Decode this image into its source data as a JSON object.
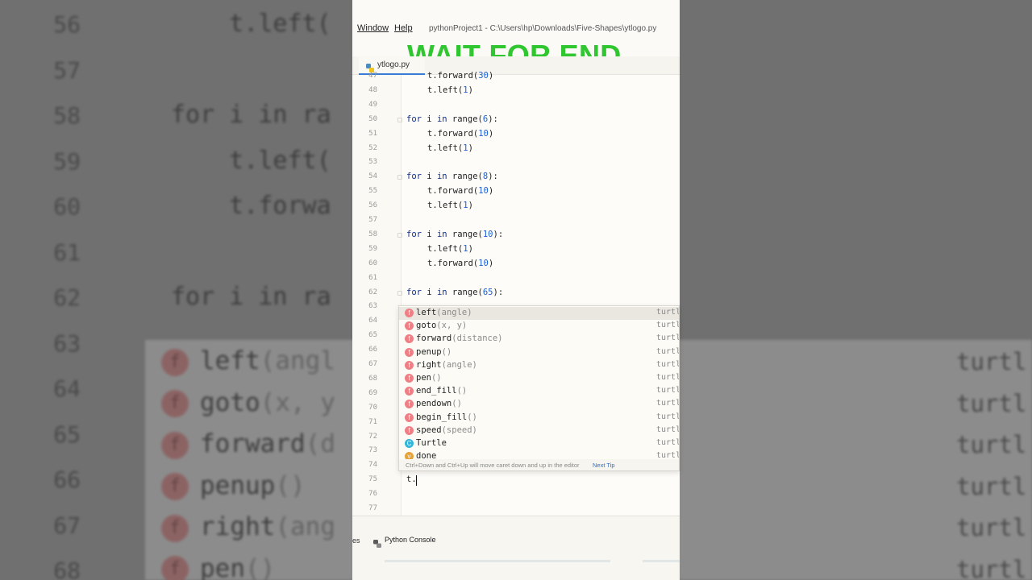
{
  "menu": {
    "window": "Window",
    "help": "Help"
  },
  "title_path": "pythonProject1 - C:\\Users\\hp\\Downloads\\Five-Shapes\\ytlogo.py",
  "overlay_text": "WAIT FOR END",
  "tab": {
    "filename": "ytlogo.py"
  },
  "left_dash": "-",
  "editor": {
    "lines": [
      {
        "n": "47",
        "kind": "code",
        "indent": 1,
        "text": "t.forward(30)"
      },
      {
        "n": "48",
        "kind": "code",
        "indent": 1,
        "text": "t.left(1)"
      },
      {
        "n": "49",
        "kind": "blank"
      },
      {
        "n": "50",
        "kind": "for",
        "num": "6"
      },
      {
        "n": "51",
        "kind": "code",
        "indent": 1,
        "text": "t.forward(10)"
      },
      {
        "n": "52",
        "kind": "code",
        "indent": 1,
        "text": "t.left(1)"
      },
      {
        "n": "53",
        "kind": "blank"
      },
      {
        "n": "54",
        "kind": "for",
        "num": "8"
      },
      {
        "n": "55",
        "kind": "code",
        "indent": 1,
        "text": "t.forward(10)"
      },
      {
        "n": "56",
        "kind": "code",
        "indent": 1,
        "text": "t.left(1)"
      },
      {
        "n": "57",
        "kind": "blank"
      },
      {
        "n": "58",
        "kind": "for",
        "num": "10"
      },
      {
        "n": "59",
        "kind": "code",
        "indent": 1,
        "text": "t.left(1)"
      },
      {
        "n": "60",
        "kind": "code",
        "indent": 1,
        "text": "t.forward(10)"
      },
      {
        "n": "61",
        "kind": "blank"
      },
      {
        "n": "62",
        "kind": "for",
        "num": "65"
      },
      {
        "n": "63",
        "kind": "blank"
      },
      {
        "n": "64",
        "kind": "blank"
      },
      {
        "n": "65",
        "kind": "blank"
      },
      {
        "n": "66",
        "kind": "blank"
      },
      {
        "n": "67",
        "kind": "blank"
      },
      {
        "n": "68",
        "kind": "blank"
      },
      {
        "n": "69",
        "kind": "blank"
      },
      {
        "n": "70",
        "kind": "blank"
      },
      {
        "n": "71",
        "kind": "blank"
      },
      {
        "n": "72",
        "kind": "blank"
      },
      {
        "n": "73",
        "kind": "blank"
      },
      {
        "n": "74",
        "kind": "blank"
      },
      {
        "n": "75",
        "kind": "code",
        "indent": 0,
        "text": "t."
      },
      {
        "n": "76",
        "kind": "blank"
      },
      {
        "n": "77",
        "kind": "blank"
      }
    ],
    "for_prefix": "for",
    "for_var": " i ",
    "for_in": "in",
    "for_range": " range(",
    "for_suffix": "):"
  },
  "completion": {
    "items": [
      {
        "name": "left",
        "params": "(angle)",
        "icon": "f",
        "type": "function",
        "source": "turtl",
        "selected": true
      },
      {
        "name": "goto",
        "params": "(x, y)",
        "icon": "f",
        "type": "function",
        "source": "turtl"
      },
      {
        "name": "forward",
        "params": "(distance)",
        "icon": "f",
        "type": "function",
        "source": "turtl"
      },
      {
        "name": "penup",
        "params": "()",
        "icon": "f",
        "type": "function",
        "source": "turtl"
      },
      {
        "name": "right",
        "params": "(angle)",
        "icon": "f",
        "type": "function",
        "source": "turtl"
      },
      {
        "name": "pen",
        "params": "()",
        "icon": "f",
        "type": "function",
        "source": "turtl"
      },
      {
        "name": "end_fill",
        "params": "()",
        "icon": "f",
        "type": "function",
        "source": "turtl"
      },
      {
        "name": "pendown",
        "params": "()",
        "icon": "f",
        "type": "function",
        "source": "turtl"
      },
      {
        "name": "begin_fill",
        "params": "()",
        "icon": "f",
        "type": "function",
        "source": "turtl"
      },
      {
        "name": "speed",
        "params": "(speed)",
        "icon": "f",
        "type": "function",
        "source": "turtl"
      },
      {
        "name": "Turtle",
        "params": "",
        "icon": "C",
        "type": "class",
        "source": "turtl"
      },
      {
        "name": "done",
        "params": "",
        "icon": "v",
        "type": "variable",
        "source": "turtl"
      }
    ],
    "footer_tip": "Ctrl+Down and Ctrl+Up will move caret down and up in the editor",
    "next_tip": "Next Tip"
  },
  "bottom": {
    "side_label": "es",
    "console_label": "Python Console"
  },
  "background": {
    "lines": [
      {
        "n": "56",
        "text": "    t.left("
      },
      {
        "n": "57",
        "text": ""
      },
      {
        "n": "58",
        "text": "for i in ra"
      },
      {
        "n": "59",
        "text": "    t.left("
      },
      {
        "n": "60",
        "text": "    t.forwa"
      },
      {
        "n": "61",
        "text": ""
      },
      {
        "n": "62",
        "text": "for i in ra"
      },
      {
        "n": "63",
        "text": ""
      },
      {
        "n": "64",
        "text": ""
      },
      {
        "n": "65",
        "text": ""
      },
      {
        "n": "66",
        "text": ""
      },
      {
        "n": "67",
        "text": ""
      },
      {
        "n": "68",
        "text": ""
      }
    ],
    "popup_items": [
      {
        "name": "left",
        "params": "(angl"
      },
      {
        "name": "goto",
        "params": "(x, y"
      },
      {
        "name": "forward",
        "params": "(d"
      },
      {
        "name": "penup",
        "params": "()"
      },
      {
        "name": "right",
        "params": "(ang"
      },
      {
        "name": "pen",
        "params": "()"
      }
    ],
    "right_label": "turtl"
  },
  "colors": {
    "overlay": "#2fc62f",
    "keyword": "#0d2f8f",
    "number": "#1a5fd0",
    "fn_icon": "#f07e85",
    "class_icon": "#33b6d8",
    "tab_underline": "#3a7bd5"
  }
}
